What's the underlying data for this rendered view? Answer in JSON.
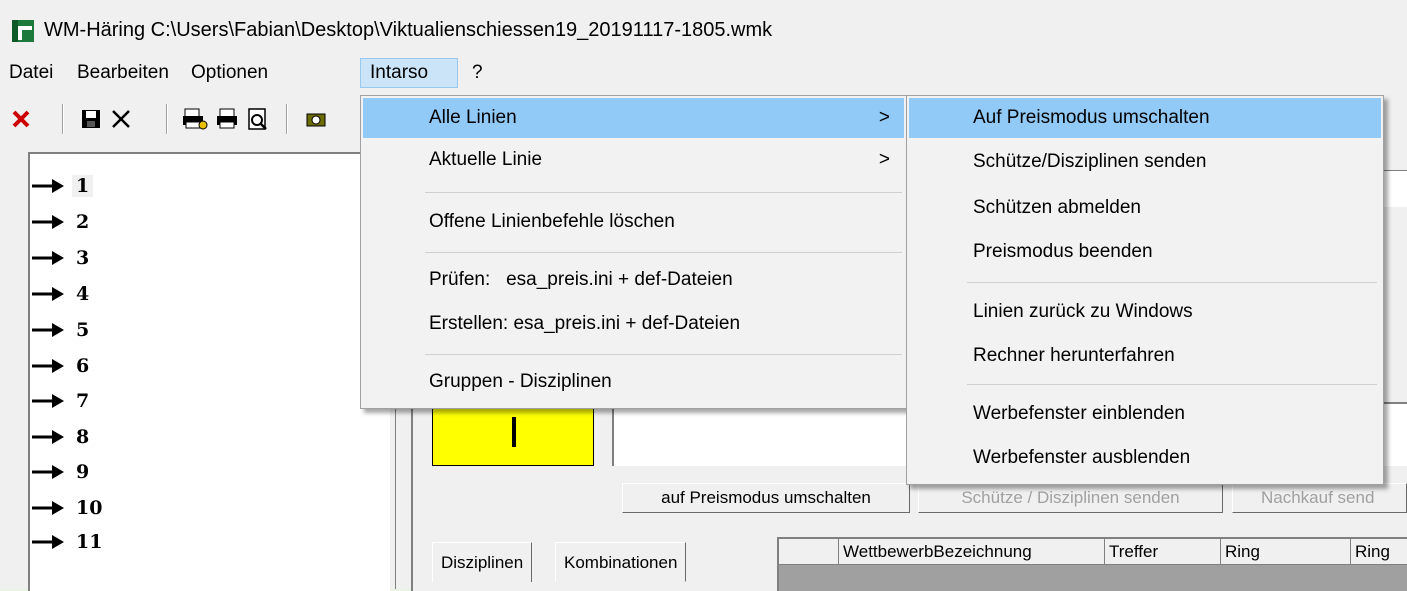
{
  "window": {
    "title": "WM-Häring C:\\Users\\Fabian\\Desktop\\Viktualienschiessen19_20191117-1805.wmk"
  },
  "menubar": {
    "items": [
      "Datei",
      "Bearbeiten",
      "Optionen",
      "Intarso",
      "?"
    ]
  },
  "toolbar": {
    "icons": [
      "delete-icon",
      "save-icon",
      "close-icon",
      "print-setup-icon",
      "print-icon",
      "print-preview-icon",
      "camera-icon"
    ],
    "accent_red": "#cc0000"
  },
  "lines": {
    "items": [
      "1",
      "2",
      "3",
      "4",
      "5",
      "6",
      "7",
      "8",
      "9",
      "10",
      "11"
    ]
  },
  "intarso_menu": {
    "items": [
      "Alle Linien",
      "Aktuelle Linie",
      "Offene Linienbefehle löschen",
      "Prüfen:   esa_preis.ini + def-Dateien",
      "Erstellen: esa_preis.ini + def-Dateien",
      "Gruppen - Disziplinen"
    ],
    "submenu_arrow": ">"
  },
  "submenu": {
    "items": [
      "Auf Preismodus umschalten",
      "Schütze/Disziplinen senden",
      "Schützen abmelden",
      "Preismodus beenden",
      "Linien zurück zu Windows",
      "Rechner herunterfahren",
      "Werbefenster einblenden",
      "Werbefenster ausblenden"
    ]
  },
  "buttons": {
    "preismodus": "auf Preismodus umschalten",
    "schuetze": "Schütze / Disziplinen senden",
    "nachkauf": "Nachkauf send"
  },
  "tabs": [
    "Disziplinen",
    "Kombinationen"
  ],
  "grid": {
    "columns": [
      "",
      "WettbewerbBezeichnung",
      "Treffer",
      "Ring",
      "Ring"
    ]
  },
  "colors": {
    "highlight": "#91c9f7",
    "yellow": "#ffff00"
  }
}
